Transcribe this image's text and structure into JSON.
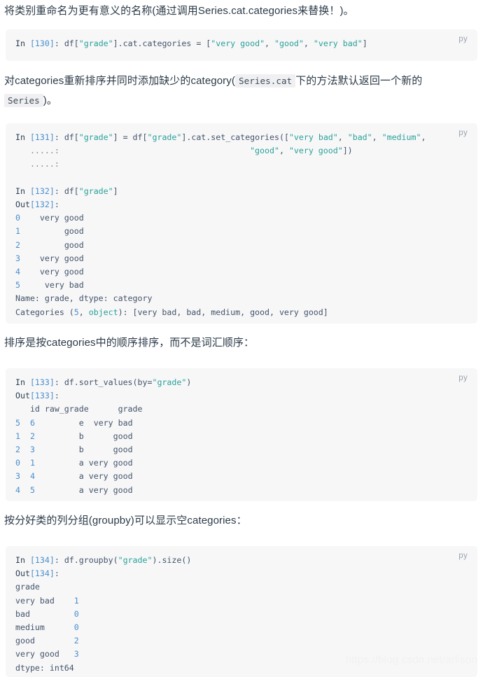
{
  "page": {
    "watermark": "https://blog.csdn.net/arlison",
    "lang_tag": "py",
    "accent_colors": {
      "code_background": "#f7f7f8",
      "page_background": "#ffffff",
      "string_token": "#2aa198",
      "number_token": "#4a8ecb",
      "default_text": "#44546a",
      "prose_text": "#2b3a47",
      "lang_tag": "#9aa4ad",
      "inline_code_background": "#f0f0f2",
      "watermark": "#f1f1f1"
    }
  },
  "paragraphs": {
    "p1": "将类别重命名为更有意义的名称(通过调用Series.cat.categories来替换！)。",
    "p2_a": "对categories重新排序并同时添加缺少的category(",
    "p2_code1": "Series.cat",
    "p2_b": "下的方法默认返回一个新的",
    "p2_code2": "Series",
    "p2_c": ")。",
    "p3": "排序是按categories中的顺序排序，而不是词汇顺序：",
    "p4": "按分好类的列分组(groupby)可以显示空categories："
  },
  "blocks": {
    "b1": {
      "prompt_in": "In",
      "counter": "[130]",
      "colon": ": ",
      "expr_a": "df[",
      "str_grade": "\"grade\"",
      "expr_b": "].cat.categories = [",
      "str_verygood": "\"very good\"",
      "sep1": ", ",
      "str_good": "\"good\"",
      "sep2": ", ",
      "str_verybad": "\"very bad\"",
      "expr_c": "]"
    },
    "b2": {
      "line1_in": "In",
      "line1_counter": "[131]",
      "line1_a": ": df[",
      "line1_s1": "\"grade\"",
      "line1_b": "] = df[",
      "line1_s2": "\"grade\"",
      "line1_c": "].cat.set_categories([",
      "line1_s3": "\"very bad\"",
      "line1_d": ", ",
      "line1_s4": "\"bad\"",
      "line1_e": ", ",
      "line1_s5": "\"medium\"",
      "line1_f": ",",
      "line2_dots": "   .....:",
      "line2_pad": "                                       ",
      "line2_s1": "\"good\"",
      "line2_a": ", ",
      "line2_s2": "\"very good\"",
      "line2_b": "])",
      "line3_dots": "   .....:",
      "line5_in": "In",
      "line5_counter": "[132]",
      "line5_a": ": df[",
      "line5_s1": "\"grade\"",
      "line5_b": "]",
      "line6_out": "Out",
      "line6_counter": "[132]",
      "line6_colon": ":",
      "series": [
        {
          "index": "0",
          "value": "very good"
        },
        {
          "index": "1",
          "value": "good"
        },
        {
          "index": "2",
          "value": "good"
        },
        {
          "index": "3",
          "value": "very good"
        },
        {
          "index": "4",
          "value": "very good"
        },
        {
          "index": "5",
          "value": "very bad"
        }
      ],
      "name_line": "Name: grade, dtype: category",
      "cat_line_a": "Categories (",
      "cat_count": "5",
      "cat_line_b": ", ",
      "cat_object": "object",
      "cat_line_c": "): [very bad, bad, medium, good, very good]"
    },
    "b3": {
      "line1_in": "In",
      "line1_counter": "[133]",
      "line1_a": ": df.sort_values(by=",
      "line1_s1": "\"grade\"",
      "line1_b": ")",
      "line2_out": "Out",
      "line2_counter": "[133]",
      "line2_colon": ":",
      "header": "   id raw_grade      grade",
      "rows": [
        {
          "index": "5",
          "id": "6",
          "raw_grade": "e",
          "grade": "very bad"
        },
        {
          "index": "1",
          "id": "2",
          "raw_grade": "b",
          "grade": "good"
        },
        {
          "index": "2",
          "id": "3",
          "raw_grade": "b",
          "grade": "good"
        },
        {
          "index": "0",
          "id": "1",
          "raw_grade": "a",
          "grade": "very good"
        },
        {
          "index": "3",
          "id": "4",
          "raw_grade": "a",
          "grade": "very good"
        },
        {
          "index": "4",
          "id": "5",
          "raw_grade": "a",
          "grade": "very good"
        }
      ]
    },
    "b4": {
      "line1_in": "In",
      "line1_counter": "[134]",
      "line1_a": ": df.groupby(",
      "line1_s1": "\"grade\"",
      "line1_b": ").size()",
      "line2_out": "Out",
      "line2_counter": "[134]",
      "line2_colon": ":",
      "index_name": "grade",
      "rows": [
        {
          "label": "very bad",
          "count": "1"
        },
        {
          "label": "bad",
          "count": "0"
        },
        {
          "label": "medium",
          "count": "0"
        },
        {
          "label": "good",
          "count": "2"
        },
        {
          "label": "very good",
          "count": "3"
        }
      ],
      "dtype_line": "dtype: int64"
    }
  }
}
